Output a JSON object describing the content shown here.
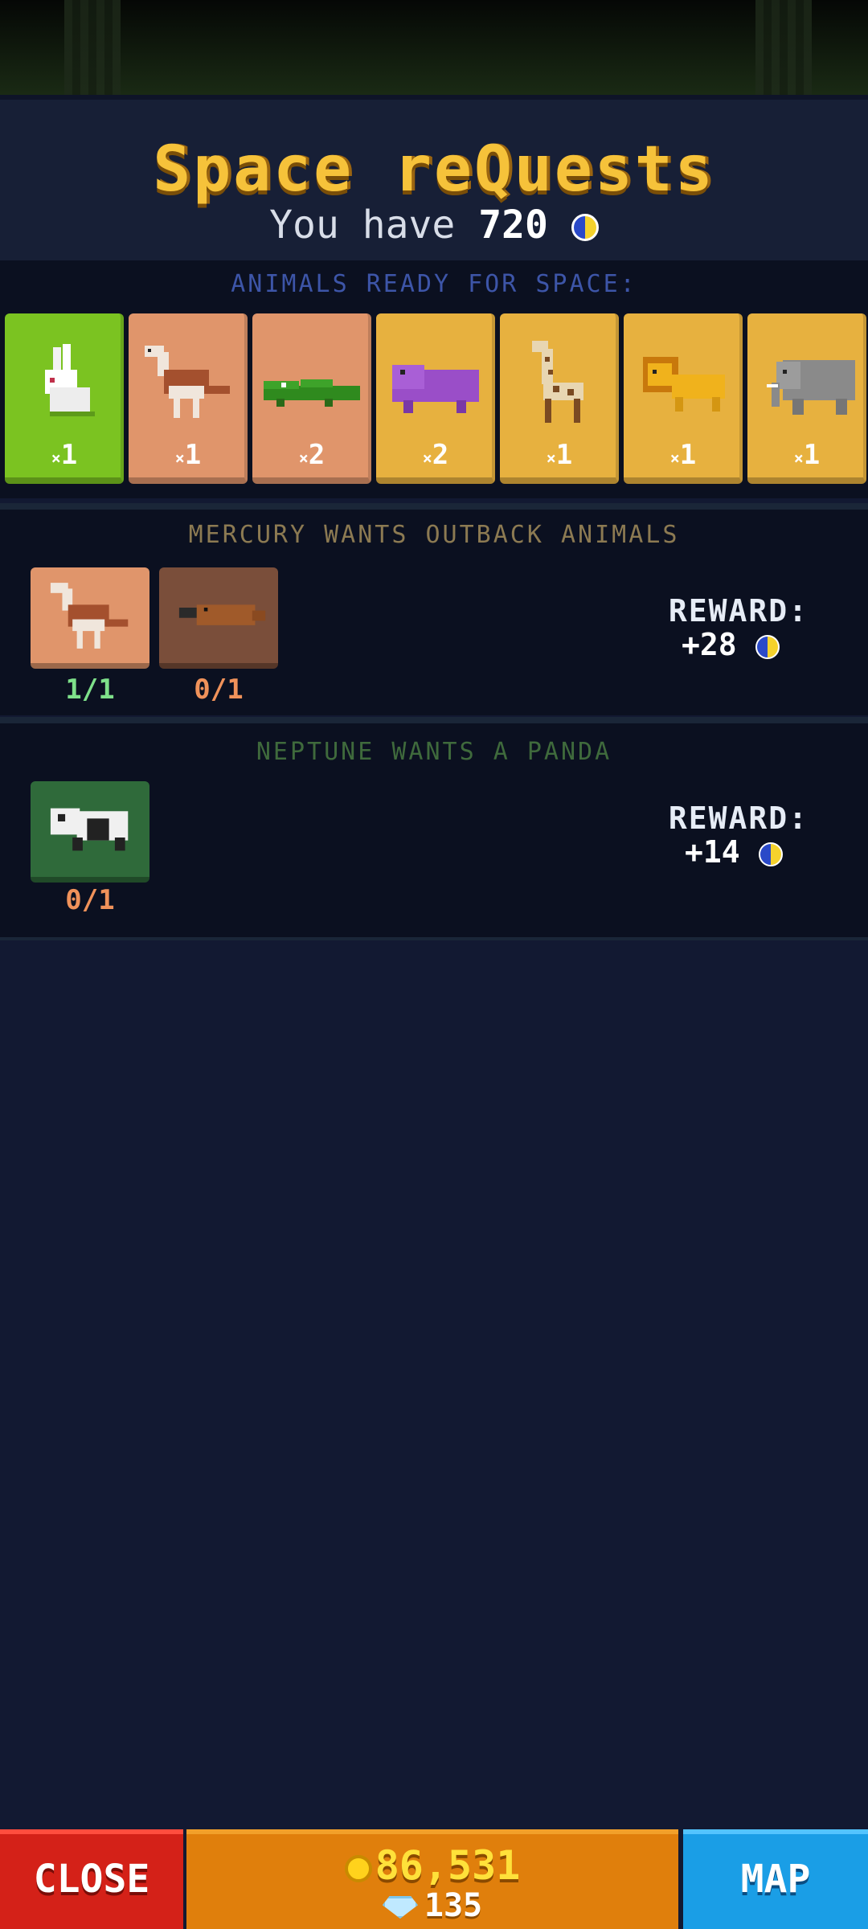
{
  "header": {
    "title": "Space reQuests",
    "balance_prefix": "You have",
    "balance_value": "720",
    "balance_icon": "space-coin-icon"
  },
  "ready": {
    "label": "ANIMALS READY FOR SPACE:",
    "label_color": "#3d55a8",
    "cards": [
      {
        "animal": "rabbit",
        "count": "1",
        "bg": "#7bc321"
      },
      {
        "animal": "emu",
        "count": "1",
        "bg": "#e0956b"
      },
      {
        "animal": "crocodile",
        "count": "2",
        "bg": "#e0956b"
      },
      {
        "animal": "hippo",
        "count": "2",
        "bg": "#e7b13f"
      },
      {
        "animal": "giraffe",
        "count": "1",
        "bg": "#e7b13f"
      },
      {
        "animal": "lion",
        "count": "1",
        "bg": "#e7b13f"
      },
      {
        "animal": "elephant",
        "count": "1",
        "bg": "#e7b13f"
      }
    ]
  },
  "requests": [
    {
      "label": "MERCURY WANTS OUTBACK ANIMALS",
      "label_color": "#8c7a52",
      "slots": [
        {
          "animal": "emu",
          "progress": "1/1",
          "bg": "#e0956b",
          "progress_color": "#7ee08a"
        },
        {
          "animal": "platypus",
          "progress": "0/1",
          "bg": "#7a4e3a",
          "progress_color": "#f0925a"
        }
      ],
      "reward_label": "REWARD:",
      "reward_value": "+28"
    },
    {
      "label": "NEPTUNE WANTS A PANDA",
      "label_color": "#3f6a3c",
      "slots": [
        {
          "animal": "panda",
          "progress": "0/1",
          "bg": "#2f6a3a",
          "progress_color": "#f0925a"
        }
      ],
      "reward_label": "REWARD:",
      "reward_value": "+14"
    }
  ],
  "bottom": {
    "close_label": "CLOSE",
    "coins": "86,531",
    "gems": "135",
    "map_label": "MAP"
  }
}
